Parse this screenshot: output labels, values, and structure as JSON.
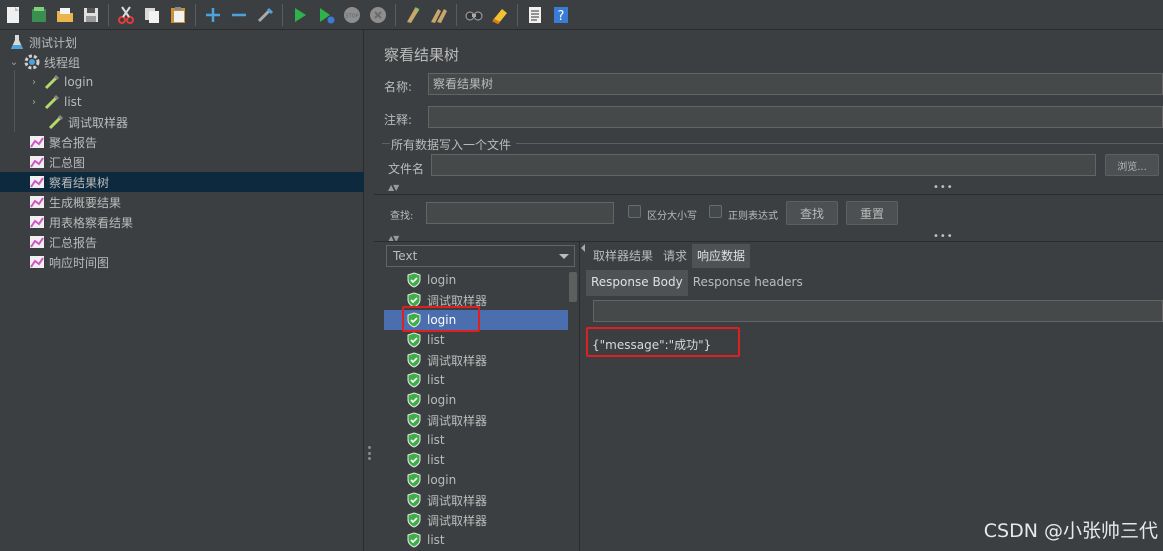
{
  "toolbar": {
    "icons": [
      "new-icon",
      "templates-icon",
      "open-icon",
      "save-icon",
      "cut-icon",
      "copy-icon",
      "paste-icon",
      "expand-icon",
      "collapse-icon",
      "toggle-icon",
      "start-icon",
      "start-no-pause-icon",
      "stop-icon",
      "shutdown-icon",
      "clear-icon",
      "clear-all-icon",
      "search-icon",
      "reset-search-icon",
      "function-helper-icon",
      "help-icon"
    ]
  },
  "tree": {
    "items": [
      {
        "label": "测试计划",
        "icon": "test-plan-icon"
      },
      {
        "label": "线程组",
        "icon": "thread-group-gear-icon"
      },
      {
        "label": "login",
        "icon": "sampler-pipette-icon"
      },
      {
        "label": "list",
        "icon": "sampler-pipette-icon"
      },
      {
        "label": "调试取样器",
        "icon": "sampler-pipette-icon"
      },
      {
        "label": "聚合报告",
        "icon": "listener-chart-icon"
      },
      {
        "label": "汇总图",
        "icon": "listener-chart-icon"
      },
      {
        "label": "察看结果树",
        "icon": "listener-chart-icon"
      },
      {
        "label": "生成概要结果",
        "icon": "listener-chart-icon"
      },
      {
        "label": "用表格察看结果",
        "icon": "listener-chart-icon"
      },
      {
        "label": "汇总报告",
        "icon": "listener-chart-icon"
      },
      {
        "label": "响应时间图",
        "icon": "listener-chart-icon"
      }
    ]
  },
  "panel": {
    "title": "察看结果树",
    "name_label": "名称:",
    "name_value": "察看结果树",
    "comment_label": "注释:",
    "comment_value": "",
    "file_group_label": "所有数据写入一个文件",
    "file_label": "文件名",
    "file_value": "",
    "browse_label": "浏览...",
    "search_label": "查找:",
    "search_value": "",
    "case_label": "区分大小写",
    "regex_label": "正则表达式",
    "find_button": "查找",
    "reset_button": "重置"
  },
  "renderer": {
    "selected": "Text"
  },
  "results": [
    {
      "label": "login"
    },
    {
      "label": "调试取样器"
    },
    {
      "label": "login"
    },
    {
      "label": "list"
    },
    {
      "label": "调试取样器"
    },
    {
      "label": "list"
    },
    {
      "label": "login"
    },
    {
      "label": "调试取样器"
    },
    {
      "label": "list"
    },
    {
      "label": "list"
    },
    {
      "label": "login"
    },
    {
      "label": "调试取样器"
    },
    {
      "label": "调试取样器"
    },
    {
      "label": "list"
    }
  ],
  "tabs": [
    "取样器结果",
    "请求",
    "响应数据"
  ],
  "subtabs": [
    "Response Body",
    "Response headers"
  ],
  "response_body": "{\"message\":\"成功\"}",
  "watermark": "CSDN @小张帅三代",
  "colors": {
    "selection": "#4b6eaf",
    "highlight": "#e02020",
    "pass_shield": "#3fae49"
  }
}
